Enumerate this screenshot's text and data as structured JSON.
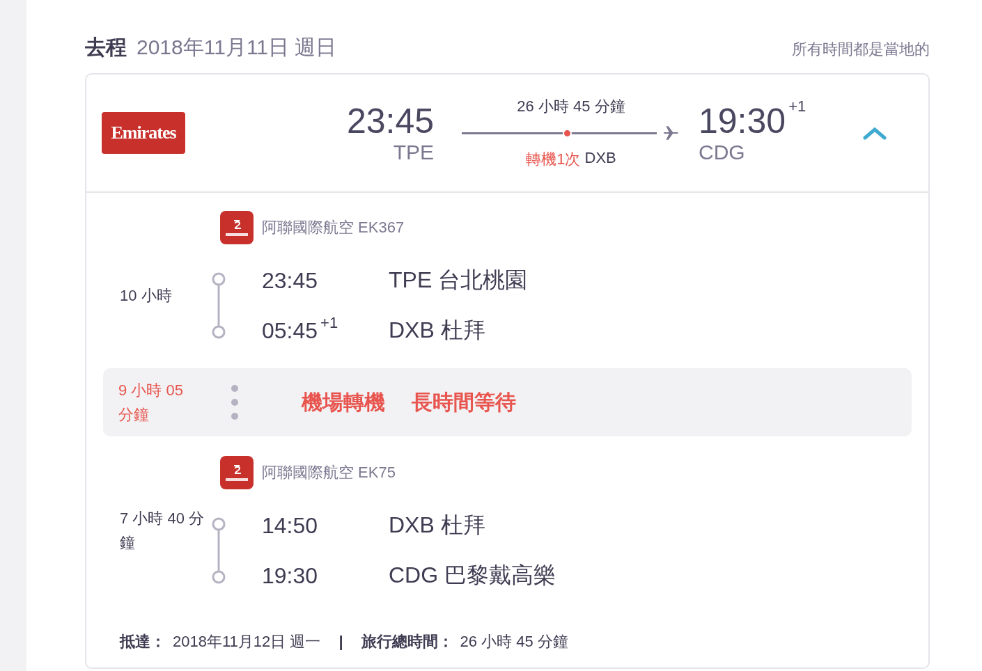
{
  "header": {
    "title": "去程",
    "date": "2018年11月11日 週日",
    "note": "所有時間都是當地的"
  },
  "summary": {
    "airline_logo": "Emirates",
    "depart_time": "23:45",
    "depart_airport": "TPE",
    "duration": "26 小時 45 分鐘",
    "stops_label": "轉機1次",
    "stop_airport": "DXB",
    "arrive_time": "19:30",
    "arrive_offset": "+1",
    "arrive_airport": "CDG",
    "expanded": true
  },
  "segments": [
    {
      "kind": "flight",
      "carrier": "阿聯國際航空 EK367",
      "duration": "10 小時",
      "points": [
        {
          "time": "23:45",
          "airport": "TPE 台北桃園"
        },
        {
          "time": "05:45",
          "offset": "+1",
          "airport": "DXB 杜拜"
        }
      ]
    },
    {
      "kind": "layover",
      "duration": "9 小時 05 分鐘",
      "tags": [
        "機場轉機",
        "長時間等待"
      ]
    },
    {
      "kind": "flight",
      "carrier": "阿聯國際航空 EK75",
      "duration": "7 小時 40 分鐘",
      "points": [
        {
          "time": "14:50",
          "airport": "DXB 杜拜"
        },
        {
          "time": "19:30",
          "airport": "CDG 巴黎戴高樂"
        }
      ]
    }
  ],
  "footer": {
    "arrival_label": "抵達：",
    "arrival_value": "2018年11月12日 週一",
    "separator": "|",
    "total_label": "旅行總時間：",
    "total_value": "26 小時 45 分鐘"
  }
}
